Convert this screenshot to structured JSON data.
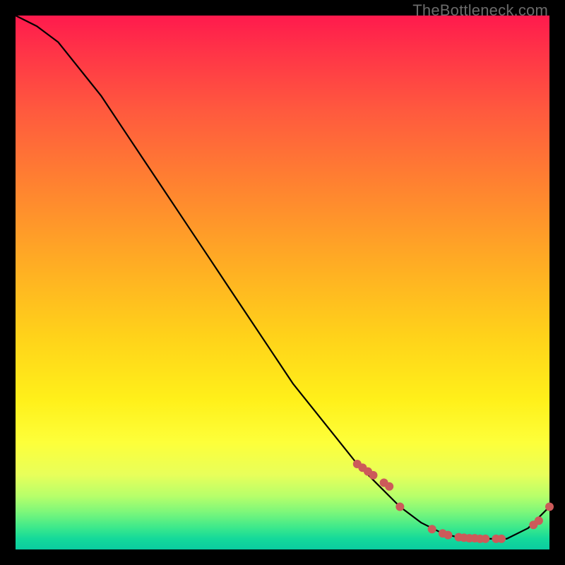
{
  "watermark": "TheBottleneck.com",
  "colors": {
    "point": "#cc5a5a",
    "line": "#000000"
  },
  "chart_data": {
    "type": "line",
    "title": "",
    "xlabel": "",
    "ylabel": "",
    "xlim": [
      0,
      100
    ],
    "ylim": [
      0,
      100
    ],
    "grid": false,
    "legend": false,
    "series": [
      {
        "name": "bottleneck-curve",
        "x": [
          0,
          4,
          8,
          12,
          16,
          20,
          24,
          28,
          32,
          36,
          40,
          44,
          48,
          52,
          56,
          60,
          64,
          68,
          72,
          76,
          80,
          84,
          88,
          92,
          96,
          100
        ],
        "y": [
          100,
          98,
          95,
          90,
          85,
          79,
          73,
          67,
          61,
          55,
          49,
          43,
          37,
          31,
          26,
          21,
          16,
          12,
          8,
          5,
          3,
          2,
          2,
          2,
          4,
          8
        ]
      }
    ],
    "scatter_points": {
      "name": "highlighted-points",
      "x": [
        64,
        65,
        66,
        67,
        69,
        70,
        72,
        78,
        80,
        81,
        83,
        84,
        85,
        86,
        87,
        88,
        90,
        91,
        97,
        98,
        100
      ],
      "y": [
        16,
        15.3,
        14.6,
        13.9,
        12.5,
        11.8,
        8.0,
        3.8,
        3.0,
        2.7,
        2.3,
        2.2,
        2.1,
        2.1,
        2.0,
        2.0,
        2.0,
        2.0,
        4.6,
        5.4,
        8.0
      ]
    }
  }
}
